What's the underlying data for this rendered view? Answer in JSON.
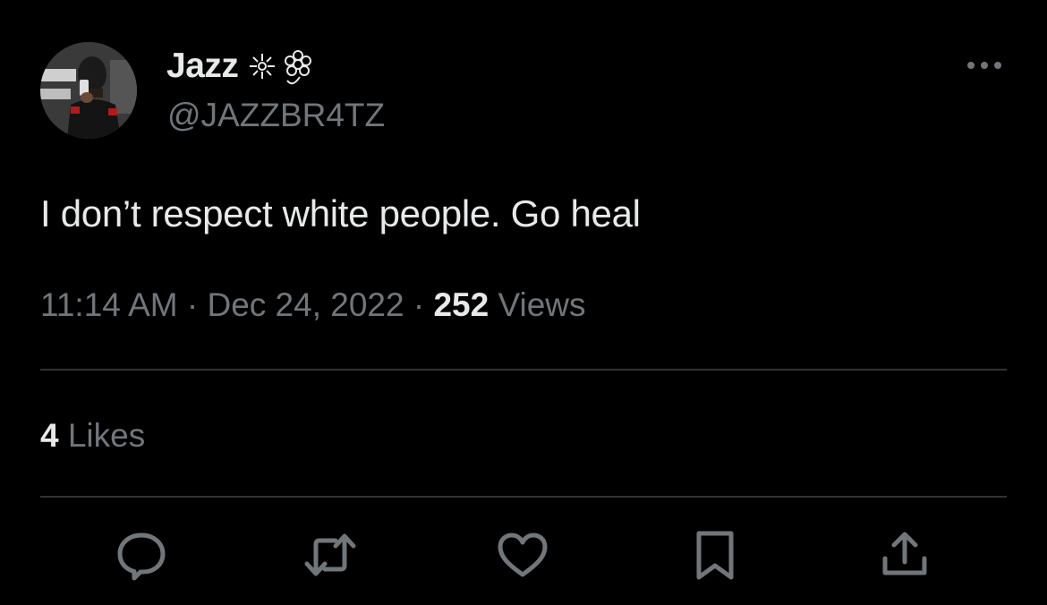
{
  "author": {
    "display_name": "Jazz",
    "handle": "@JAZZBR4TZ",
    "avatar_icon": "profile-photo"
  },
  "tweet": {
    "text": "I don’t respect white people. Go heal",
    "time": "11:14 AM",
    "separator": "·",
    "date": "Dec 24, 2022",
    "views_count": "252",
    "views_label": "Views"
  },
  "engagement": {
    "likes_count": "4",
    "likes_label": "Likes"
  },
  "actions": [
    {
      "name": "reply",
      "icon": "reply-icon"
    },
    {
      "name": "retweet",
      "icon": "retweet-icon"
    },
    {
      "name": "like",
      "icon": "heart-icon"
    },
    {
      "name": "bookmark",
      "icon": "bookmark-icon"
    },
    {
      "name": "share",
      "icon": "share-icon"
    }
  ],
  "colors": {
    "background": "#000000",
    "primary_text": "#e7e9ea",
    "secondary_text": "#71767b",
    "divider": "#2f3336"
  }
}
